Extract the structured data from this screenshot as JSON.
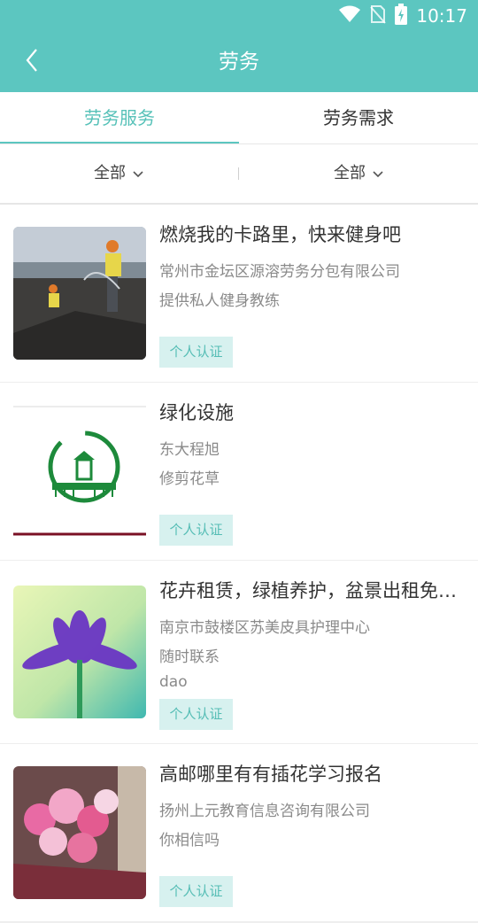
{
  "status": {
    "time": "10:17",
    "icons": [
      "wifi-icon",
      "no-sim-icon",
      "battery-charging-icon"
    ]
  },
  "header": {
    "title": "劳务"
  },
  "tabs": [
    {
      "label": "劳务服务",
      "active": true
    },
    {
      "label": "劳务需求",
      "active": false
    }
  ],
  "filters": [
    {
      "label": "全部"
    },
    {
      "label": "全部"
    }
  ],
  "colors": {
    "accent": "#5cc6c0",
    "badge_bg": "#d7f1ef",
    "badge_text": "#55bdb5"
  },
  "items": [
    {
      "title": "燃烧我的卡路里，快来健身吧",
      "company": "常州市金坛区源溶劳务分包有限公司",
      "desc": "提供私人健身教练",
      "extra": "",
      "badge": "个人认证"
    },
    {
      "title": "绿化设施",
      "company": "东大程旭",
      "desc": "修剪花草",
      "extra": "",
      "badge": "个人认证"
    },
    {
      "title": "花卉租赁，绿植养护，盆景出租免费送货",
      "company": "南京市鼓楼区苏美皮具护理中心",
      "desc": "随时联系",
      "extra": "dao",
      "badge": "个人认证"
    },
    {
      "title": "高邮哪里有有插花学习报名",
      "company": "扬州上元教育信息咨询有限公司",
      "desc": "你相信吗",
      "extra": "",
      "badge": "个人认证"
    }
  ]
}
